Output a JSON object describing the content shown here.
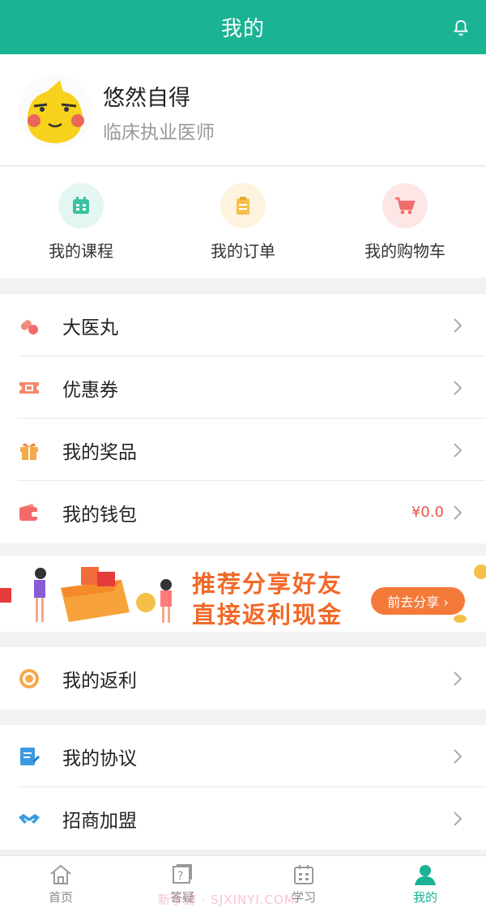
{
  "header": {
    "title": "我的"
  },
  "profile": {
    "name": "悠然自得",
    "subtitle": "临床执业医师"
  },
  "quick_actions": [
    {
      "label": "我的课程",
      "color": "#3cc2a0",
      "bg": "#e3f6f1"
    },
    {
      "label": "我的订单",
      "color": "#f5c04a",
      "bg": "#fdf3df"
    },
    {
      "label": "我的购物车",
      "color": "#f26b6b",
      "bg": "#fde6e6"
    }
  ],
  "menu_group1": [
    {
      "label": "大医丸",
      "value": ""
    },
    {
      "label": "优惠券",
      "value": ""
    },
    {
      "label": "我的奖品",
      "value": ""
    },
    {
      "label": "我的钱包",
      "value": "¥0.0"
    }
  ],
  "banner": {
    "line1": "推荐分享好友",
    "line2": "直接返利现金",
    "button": "前去分享 ›"
  },
  "menu_group2": [
    {
      "label": "我的返利"
    }
  ],
  "menu_group3": [
    {
      "label": "我的协议"
    },
    {
      "label": "招商加盟"
    }
  ],
  "tabbar": [
    {
      "label": "首页",
      "active": false
    },
    {
      "label": "答疑",
      "active": false
    },
    {
      "label": "学习",
      "active": false
    },
    {
      "label": "我的",
      "active": true
    }
  ],
  "watermark": "新手游 · SJXINYI.COM",
  "colors": {
    "accent": "#1ab394",
    "price": "#e8574a",
    "banner_text": "#f06a2a"
  }
}
